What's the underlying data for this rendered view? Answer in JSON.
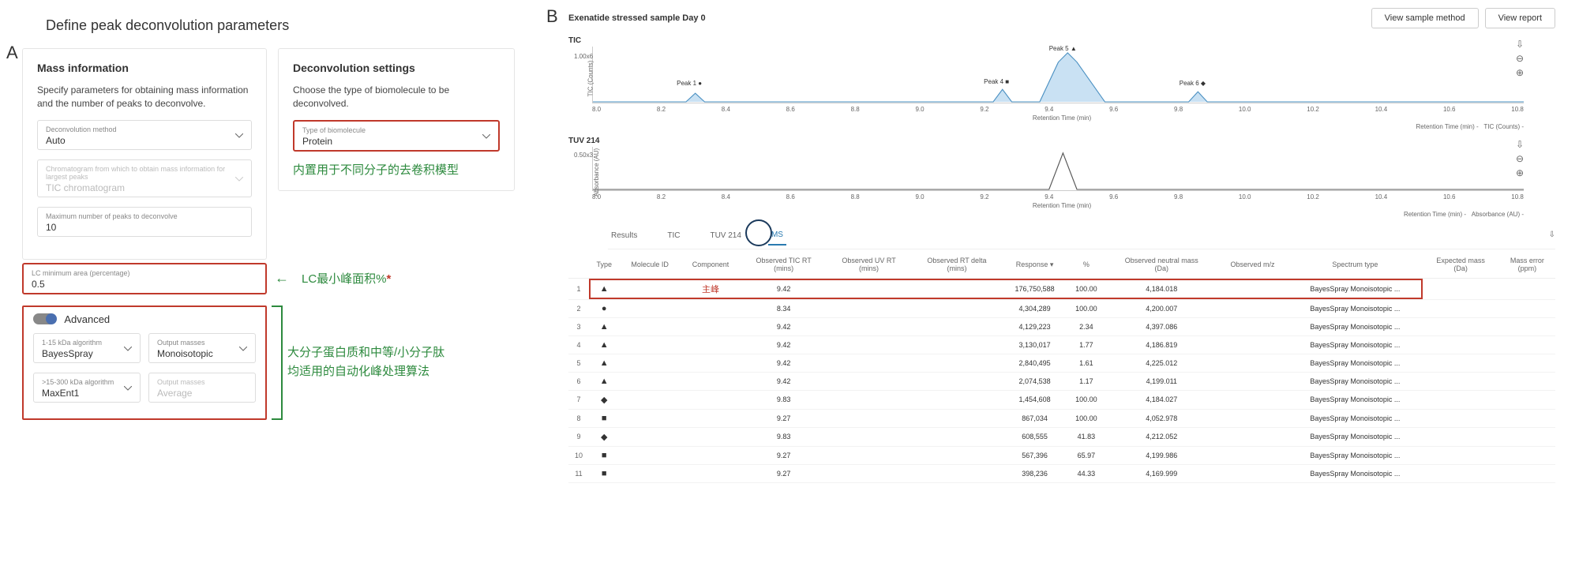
{
  "figLabelA": "A",
  "figLabelB": "B",
  "panelA": {
    "title": "Define peak deconvolution parameters",
    "massInfo": {
      "heading": "Mass information",
      "desc": "Specify parameters for obtaining mass information and the number of peaks to deconvolve.",
      "decon_method": {
        "label": "Deconvolution method",
        "value": "Auto"
      },
      "chromatogram": {
        "label": "Chromatogram from which to obtain mass information for largest peaks",
        "value": "TIC chromatogram"
      },
      "max_peaks": {
        "label": "Maximum number of peaks to deconvolve",
        "value": "10"
      },
      "lc_min": {
        "label": "LC minimum area (percentage)",
        "value": "0.5"
      }
    },
    "deconSettings": {
      "heading": "Deconvolution settings",
      "desc": "Choose the type of biomolecule to be deconvolved.",
      "biomol": {
        "label": "Type of biomolecule",
        "value": "Protein"
      }
    },
    "annotations": {
      "ann1": "内置用于不同分子的去卷积模型",
      "ann2": "LC最小峰面积%",
      "ann3": "大分子蛋白质和中等/小分子肽\n均适用的自动化峰处理算法"
    },
    "advanced": {
      "toggleLabel": "Advanced",
      "algo_1_15": {
        "label": "1-15 kDa algorithm",
        "value": "BayesSpray"
      },
      "out_mass1": {
        "label": "Output masses",
        "value": "Monoisotopic"
      },
      "algo_15_300": {
        "label": ">15-300 kDa algorithm",
        "value": "MaxEnt1"
      },
      "out_mass2": {
        "label": "Output masses",
        "value": "Average"
      }
    }
  },
  "panelB": {
    "sampleTitle": "Exenatide stressed sample Day 0",
    "btn_view_method": "View sample method",
    "btn_view_report": "View report",
    "tic_title": "TIC",
    "tuv_title": "TUV 214",
    "tic_y_label": "TIC (Counts)",
    "tuv_y_label": "Absorbance (AU)",
    "x_label": "Retention Time (min)",
    "tic_footer_a": "Retention Time (min) -",
    "tic_footer_b": "TIC (Counts) -",
    "tuv_footer_a": "Retention Time (min) -",
    "tuv_footer_b": "Absorbance (AU) -",
    "tic_y_tick": "1.00x6",
    "tuv_y_tick": "0.50x3",
    "ticks": [
      "8.0",
      "8.2",
      "8.4",
      "8.6",
      "8.8",
      "9.0",
      "9.2",
      "9.4",
      "9.6",
      "9.8",
      "10.0",
      "10.2",
      "10.4",
      "10.6",
      "10.8"
    ],
    "peaks": {
      "p1": "Peak 1 ●",
      "p4": "Peak 4 ■",
      "p5": "Peak 5 ▲",
      "p6": "Peak 6 ◆"
    },
    "tabs": {
      "results": "Results",
      "tic": "TIC",
      "tuv": "TUV 214",
      "ms": "MS"
    },
    "zf": "主峰",
    "columns": [
      "",
      "Type",
      "Molecule ID",
      "Component",
      "Observed TIC RT (mins)",
      "Observed UV RT (mins)",
      "Observed RT delta (mins)",
      "Response ▾",
      "%",
      "Observed neutral mass (Da)",
      "Observed m/z",
      "Spectrum type",
      "Expected mass (Da)",
      "Mass error (ppm)"
    ],
    "rows": [
      {
        "i": "1",
        "sym": "▲",
        "rt": "9.42",
        "uv": "",
        "d": "",
        "resp": "176,750,588",
        "pct": "100.00",
        "mass": "4,184.018",
        "mz": "",
        "spec": "BayesSpray Monoisotopic ...",
        "hl": true
      },
      {
        "i": "2",
        "sym": "●",
        "rt": "8.34",
        "uv": "",
        "d": "",
        "resp": "4,304,289",
        "pct": "100.00",
        "mass": "4,200.007",
        "mz": "",
        "spec": "BayesSpray Monoisotopic ..."
      },
      {
        "i": "3",
        "sym": "▲",
        "rt": "9.42",
        "uv": "",
        "d": "",
        "resp": "4,129,223",
        "pct": "2.34",
        "mass": "4,397.086",
        "mz": "",
        "spec": "BayesSpray Monoisotopic ..."
      },
      {
        "i": "4",
        "sym": "▲",
        "rt": "9.42",
        "uv": "",
        "d": "",
        "resp": "3,130,017",
        "pct": "1.77",
        "mass": "4,186.819",
        "mz": "",
        "spec": "BayesSpray Monoisotopic ..."
      },
      {
        "i": "5",
        "sym": "▲",
        "rt": "9.42",
        "uv": "",
        "d": "",
        "resp": "2,840,495",
        "pct": "1.61",
        "mass": "4,225.012",
        "mz": "",
        "spec": "BayesSpray Monoisotopic ..."
      },
      {
        "i": "6",
        "sym": "▲",
        "rt": "9.42",
        "uv": "",
        "d": "",
        "resp": "2,074,538",
        "pct": "1.17",
        "mass": "4,199.011",
        "mz": "",
        "spec": "BayesSpray Monoisotopic ..."
      },
      {
        "i": "7",
        "sym": "◆",
        "rt": "9.83",
        "uv": "",
        "d": "",
        "resp": "1,454,608",
        "pct": "100.00",
        "mass": "4,184.027",
        "mz": "",
        "spec": "BayesSpray Monoisotopic ..."
      },
      {
        "i": "8",
        "sym": "■",
        "rt": "9.27",
        "uv": "",
        "d": "",
        "resp": "867,034",
        "pct": "100.00",
        "mass": "4,052.978",
        "mz": "",
        "spec": "BayesSpray Monoisotopic ..."
      },
      {
        "i": "9",
        "sym": "◆",
        "rt": "9.83",
        "uv": "",
        "d": "",
        "resp": "608,555",
        "pct": "41.83",
        "mass": "4,212.052",
        "mz": "",
        "spec": "BayesSpray Monoisotopic ..."
      },
      {
        "i": "10",
        "sym": "■",
        "rt": "9.27",
        "uv": "",
        "d": "",
        "resp": "567,396",
        "pct": "65.97",
        "mass": "4,199.986",
        "mz": "",
        "spec": "BayesSpray Monoisotopic ..."
      },
      {
        "i": "11",
        "sym": "■",
        "rt": "9.27",
        "uv": "",
        "d": "",
        "resp": "398,236",
        "pct": "44.33",
        "mass": "4,169.999",
        "mz": "",
        "spec": "BayesSpray Monoisotopic ..."
      }
    ]
  },
  "chart_data": [
    {
      "type": "line",
      "name": "TIC",
      "xlabel": "Retention Time (min)",
      "ylabel": "TIC (Counts)",
      "xlim": [
        8.0,
        10.8
      ],
      "x": [
        8.0,
        8.3,
        8.35,
        8.4,
        9.2,
        9.25,
        9.3,
        9.4,
        9.45,
        9.5,
        9.6,
        9.8,
        9.85,
        9.9,
        10.8
      ],
      "y": [
        0,
        0,
        5000000,
        0,
        0,
        6000000,
        0,
        80000000,
        176000000,
        60000000,
        0,
        0,
        7000000,
        0,
        0
      ],
      "annotations": [
        "Peak 1",
        "Peak 4",
        "Peak 5",
        "Peak 6"
      ]
    },
    {
      "type": "line",
      "name": "TUV 214",
      "xlabel": "Retention Time (min)",
      "ylabel": "Absorbance (AU)",
      "xlim": [
        8.0,
        10.8
      ],
      "x": [
        8.0,
        9.35,
        9.42,
        9.5,
        10.8
      ],
      "y": [
        0,
        0,
        0.5,
        0,
        0
      ]
    }
  ]
}
